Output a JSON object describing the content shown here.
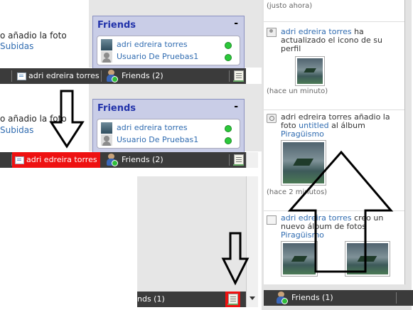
{
  "panel_top": {
    "fragment_text": "o añadio la foto",
    "fragment_link": "Subidas",
    "chat_tab_label": "adri edreira torres",
    "friends_tab_label": "Friends (2)",
    "friends_box": {
      "title": "Friends",
      "minimize": "-",
      "friends": [
        {
          "name": "adri edreira torres",
          "status": "online"
        },
        {
          "name": "Usuario De Pruebas1",
          "status": "online"
        }
      ]
    }
  },
  "panel_middle": {
    "fragment_text": "o añadio la foto",
    "fragment_link": "Subidas",
    "chat_tab_label": "adri edreira torres",
    "chat_tab_state": "highlighted",
    "friends_tab_label": "Friends (2)",
    "friends_box": {
      "title": "Friends",
      "minimize": "-",
      "friends": [
        {
          "name": "adri edreira torres",
          "status": "online"
        },
        {
          "name": "Usuario De Pruebas1",
          "status": "online"
        }
      ]
    }
  },
  "panel_bottom": {
    "friends_tab_label": "nds (1)",
    "corner_state": "highlighted"
  },
  "activity_feed": {
    "top_time": "(justo ahora)",
    "items": [
      {
        "icon": "user-icon",
        "actor": "adri edreira torres",
        "text": "ha actualizado el icono de su perfil",
        "time": "(hace un minuto)"
      },
      {
        "icon": "camera-icon",
        "actor": "adri edreira torres",
        "text_before": "añadio la foto",
        "photo_link": "untitled",
        "text_mid": "al álbum",
        "album_link": "Piragüismo",
        "time": "(hace 2 minutos)"
      },
      {
        "icon": "album-icon",
        "actor": "adri edreira torres",
        "text": "creo un nuevo álbum de fotos",
        "album_link": "Piragüismo"
      }
    ],
    "friends_tab_label": "Friends (1)"
  },
  "colors": {
    "chatbar": "#3b3b3b",
    "highlight": "#ee1111",
    "friends_box_bg": "#c9cde7",
    "friends_title": "#2233aa",
    "link": "#2f6bb0",
    "online": "#2bc83a"
  }
}
